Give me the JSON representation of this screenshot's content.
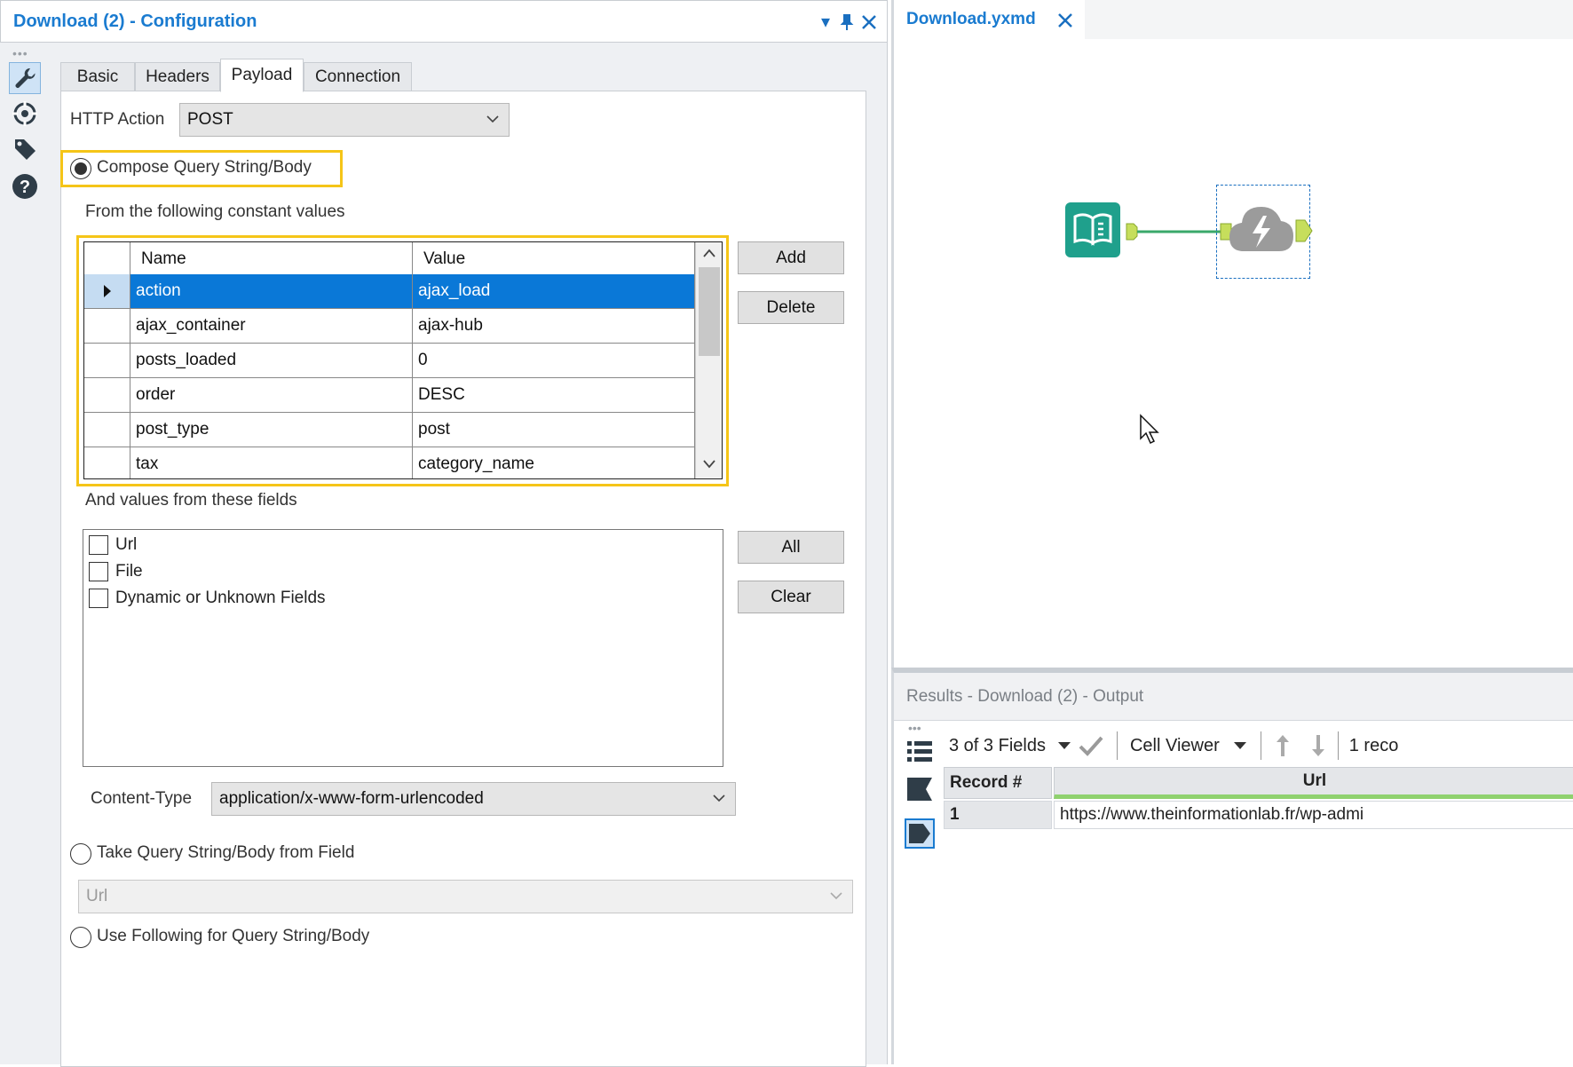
{
  "config": {
    "title": "Download (2) - Configuration",
    "tabs": [
      {
        "label": "Basic"
      },
      {
        "label": "Headers"
      },
      {
        "label": "Payload"
      },
      {
        "label": "Connection"
      }
    ],
    "http_action": {
      "label": "HTTP Action",
      "value": "POST"
    },
    "compose_option": {
      "label": "Compose Query String/Body",
      "selected": true
    },
    "constants_label": "From the following constant values",
    "grid": {
      "columns": [
        "Name",
        "Value"
      ],
      "rows": [
        {
          "name": "action",
          "value": "ajax_load",
          "selected": true
        },
        {
          "name": "ajax_container",
          "value": "ajax-hub"
        },
        {
          "name": "posts_loaded",
          "value": "0"
        },
        {
          "name": "order",
          "value": "DESC"
        },
        {
          "name": "post_type",
          "value": "post"
        },
        {
          "name": "tax",
          "value": "category_name"
        }
      ]
    },
    "add_button": "Add",
    "delete_button": "Delete",
    "fields_label": "And values from these fields",
    "fields": [
      {
        "label": "Url",
        "checked": false
      },
      {
        "label": "File",
        "checked": false
      },
      {
        "label": "Dynamic or Unknown Fields",
        "checked": false
      }
    ],
    "all_button": "All",
    "clear_button": "Clear",
    "content_type": {
      "label": "Content-Type",
      "value": "application/x-www-form-urlencoded"
    },
    "take_field_option": {
      "label": "Take Query String/Body from Field",
      "selected": false
    },
    "field_select": {
      "value": "Url"
    },
    "use_following_option": {
      "label": "Use Following for Query String/Body",
      "selected": false
    }
  },
  "canvas": {
    "tab_label": "Download.yxmd"
  },
  "results": {
    "title": "Results - Download (2) - Output",
    "fields_selector": "3 of 3 Fields",
    "viewer": "Cell Viewer",
    "records_text": "1 reco",
    "columns": [
      "Record #",
      "Url"
    ],
    "rows": [
      {
        "record": "1",
        "url": "https://www.theinformationlab.fr/wp-admi"
      }
    ]
  },
  "colors": {
    "accent": "#1a7bd0",
    "highlight": "#f5c518",
    "selection": "#0a78d7"
  },
  "icons": [
    "wrench-icon",
    "target-icon",
    "tag-icon",
    "help-icon",
    "book-icon",
    "download-tool-icon",
    "cursor-icon"
  ]
}
